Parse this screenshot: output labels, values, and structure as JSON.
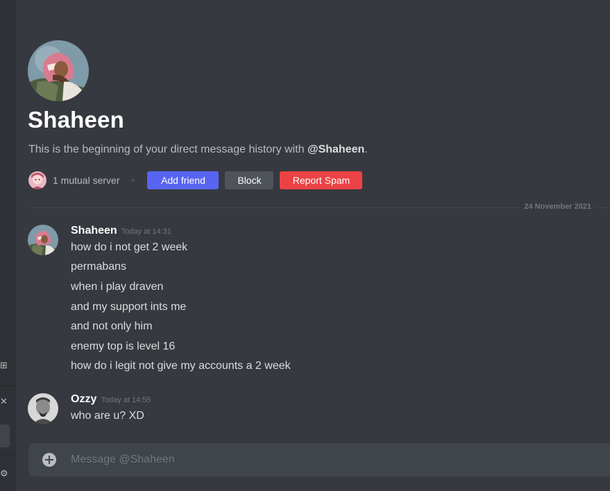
{
  "profile": {
    "name": "Shaheen",
    "intro_prefix": "This is the beginning of your direct message history with ",
    "intro_handle": "@Shaheen",
    "intro_suffix": ".",
    "mutual_servers": "1 mutual server"
  },
  "actions": {
    "add_friend": "Add friend",
    "block": "Block",
    "report_spam": "Report Spam"
  },
  "colors": {
    "blurple": "#5865f2",
    "danger": "#ed4245",
    "neutral": "#4f545c",
    "background": "#36393f"
  },
  "date_divider": "24 November 2021",
  "messages": [
    {
      "author": "Shaheen",
      "time": "Today at 14:31",
      "lines": [
        "how do i not get 2 week",
        "permabans",
        "when i play draven",
        "and my support ints me",
        "and not only him",
        "enemy top is level 16",
        "how do i legit not give my accounts a 2 week"
      ]
    },
    {
      "author": "Ozzy",
      "time": "Today at 14:55",
      "lines": [
        "who are u? XD"
      ]
    }
  ],
  "composer": {
    "placeholder": "Message @Shaheen"
  },
  "icons": {
    "sidebar": [
      "controller-icon",
      "close-icon",
      "gear-icon"
    ],
    "composer": "plus-circle-icon"
  }
}
